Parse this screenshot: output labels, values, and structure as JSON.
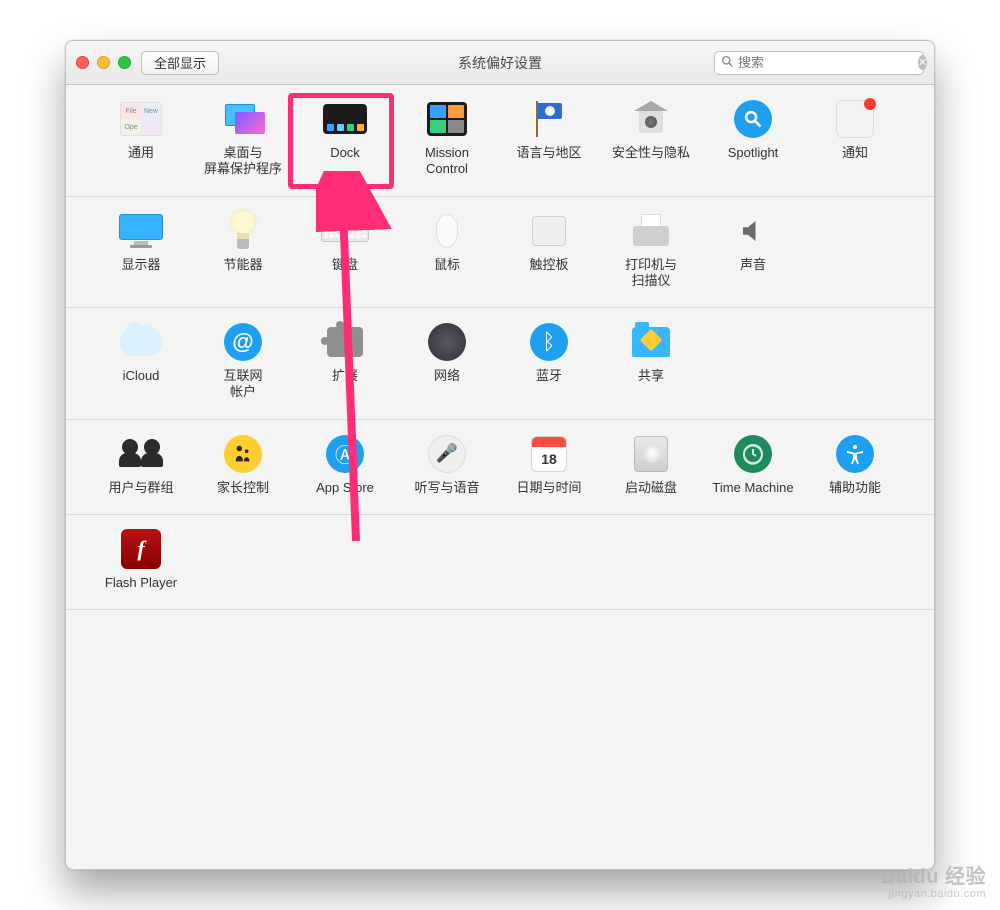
{
  "window": {
    "title": "系统偏好设置",
    "show_all": "全部显示"
  },
  "search": {
    "placeholder": "搜索"
  },
  "rows": [
    {
      "items": [
        {
          "id": "general",
          "label": "通用"
        },
        {
          "id": "desktop",
          "label": "桌面与\n屏幕保护程序"
        },
        {
          "id": "dock",
          "label": "Dock"
        },
        {
          "id": "mission",
          "label": "Mission\nControl"
        },
        {
          "id": "language",
          "label": "语言与地区"
        },
        {
          "id": "security",
          "label": "安全性与隐私"
        },
        {
          "id": "spotlight",
          "label": "Spotlight"
        },
        {
          "id": "notif",
          "label": "通知"
        }
      ]
    },
    {
      "items": [
        {
          "id": "display",
          "label": "显示器"
        },
        {
          "id": "energy",
          "label": "节能器"
        },
        {
          "id": "keyboard",
          "label": "键盘"
        },
        {
          "id": "mouse",
          "label": "鼠标"
        },
        {
          "id": "trackpad",
          "label": "触控板"
        },
        {
          "id": "printer",
          "label": "打印机与\n扫描仪"
        },
        {
          "id": "sound",
          "label": "声音"
        }
      ]
    },
    {
      "items": [
        {
          "id": "icloud",
          "label": "iCloud"
        },
        {
          "id": "internet",
          "label": "互联网\n帐户"
        },
        {
          "id": "ext",
          "label": "扩展"
        },
        {
          "id": "network",
          "label": "网络"
        },
        {
          "id": "bt",
          "label": "蓝牙"
        },
        {
          "id": "sharing",
          "label": "共享"
        }
      ]
    },
    {
      "items": [
        {
          "id": "users",
          "label": "用户与群组"
        },
        {
          "id": "parental",
          "label": "家长控制"
        },
        {
          "id": "appstore",
          "label": "App Store"
        },
        {
          "id": "dictation",
          "label": "听写与语音"
        },
        {
          "id": "datetime",
          "label": "日期与时间"
        },
        {
          "id": "startup",
          "label": "启动磁盘"
        },
        {
          "id": "tm",
          "label": "Time Machine"
        },
        {
          "id": "access",
          "label": "辅助功能"
        }
      ]
    },
    {
      "items": [
        {
          "id": "flash",
          "label": "Flash Player"
        }
      ]
    }
  ],
  "date_badge": "18",
  "annotation": {
    "highlighted": "dock"
  },
  "watermark": {
    "brand": "Baidu 经验",
    "url": "jingyan.baidu.com"
  }
}
